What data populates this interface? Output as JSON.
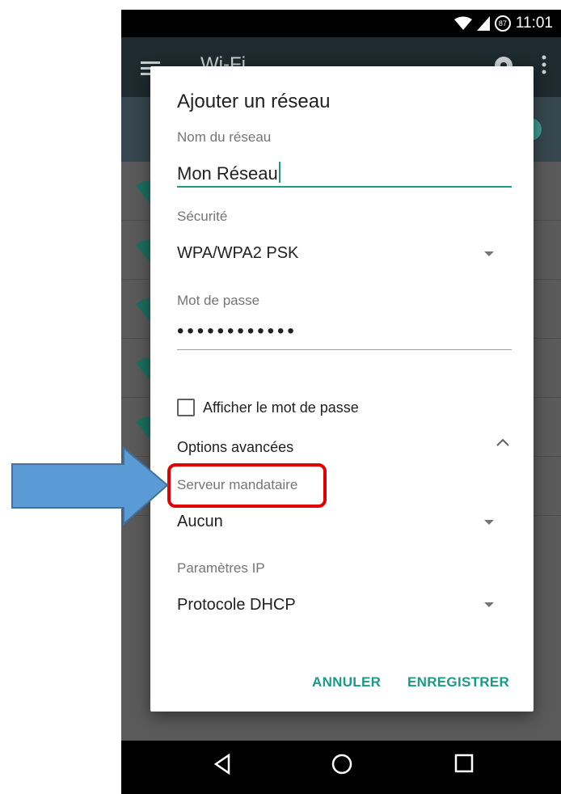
{
  "status_bar": {
    "time": "11:01",
    "notification_count": "87"
  },
  "app_bar": {
    "title": "Wi-Fi"
  },
  "dialog": {
    "title": "Ajouter un réseau",
    "network_name_label": "Nom du réseau",
    "network_name_value": "Mon Réseau",
    "security_label": "Sécurité",
    "security_value": "WPA/WPA2 PSK",
    "password_label": "Mot de passe",
    "password_mask": "••••••••••••",
    "show_password_label": "Afficher le mot de passe",
    "show_password_checked": false,
    "advanced_options_label": "Options avancées",
    "proxy_label": "Serveur mandataire",
    "proxy_value": "Aucun",
    "ip_settings_label": "Paramètres IP",
    "ip_settings_value": "Protocole DHCP",
    "cancel_label": "ANNULER",
    "save_label": "ENREGISTRER"
  },
  "colors": {
    "accent": "#1b9a86",
    "highlight": "#e10000",
    "callout_arrow": "#5b9bd5"
  },
  "icons": [
    "menu-icon",
    "gear-icon",
    "more-vert-icon",
    "wifi-icon",
    "cell-signal-icon",
    "back-icon",
    "home-icon",
    "recents-icon",
    "chevron-up-icon",
    "dropdown-arrow-icon"
  ]
}
